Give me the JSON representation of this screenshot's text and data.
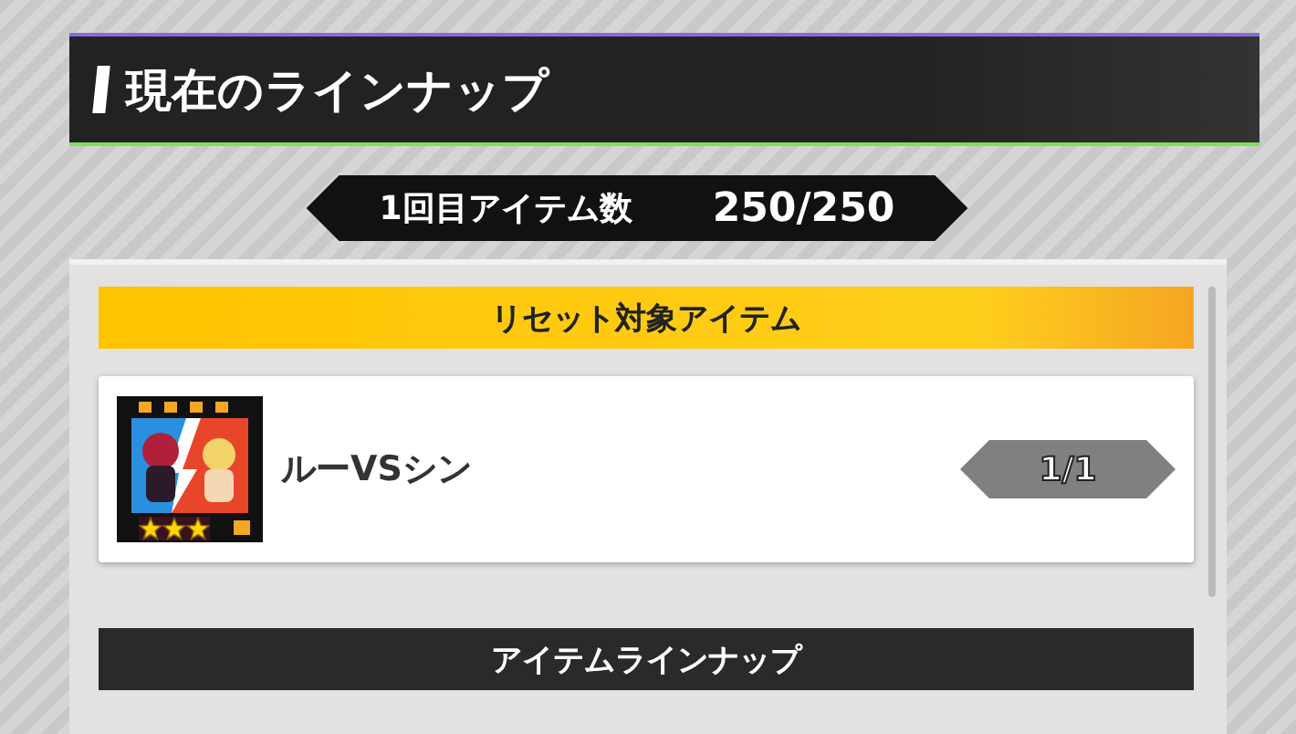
{
  "header": {
    "title": "現在のラインナップ"
  },
  "counter": {
    "label": "1回目アイテム数",
    "value": "250/250"
  },
  "sections": [
    {
      "kind": "reset",
      "title": "リセット対象アイテム",
      "items": [
        {
          "name": "ルーVSシン",
          "stars": 3,
          "count": "1/1"
        }
      ]
    },
    {
      "kind": "lineup",
      "title": "アイテムラインナップ"
    }
  ]
}
